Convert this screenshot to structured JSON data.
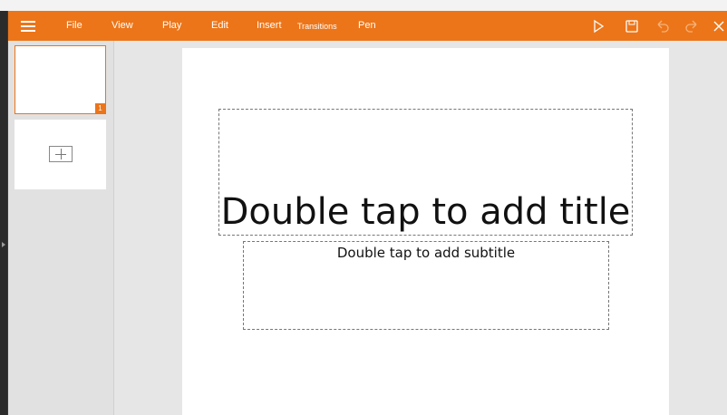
{
  "toolbar": {
    "menu_icon": "hamburger-icon",
    "menus": [
      "File",
      "View",
      "Play",
      "Edit",
      "Insert",
      "Transitions",
      "Pen"
    ],
    "actions": [
      "play-icon",
      "save-icon",
      "undo-icon",
      "redo-icon",
      "close-icon"
    ],
    "accent_color": "#ec7519"
  },
  "sidebar": {
    "slides": [
      {
        "number": "1"
      }
    ],
    "add_icon": "add-slide-icon"
  },
  "slide": {
    "title_placeholder": "Double tap to add title",
    "subtitle_placeholder": "Double tap to add subtitle"
  }
}
